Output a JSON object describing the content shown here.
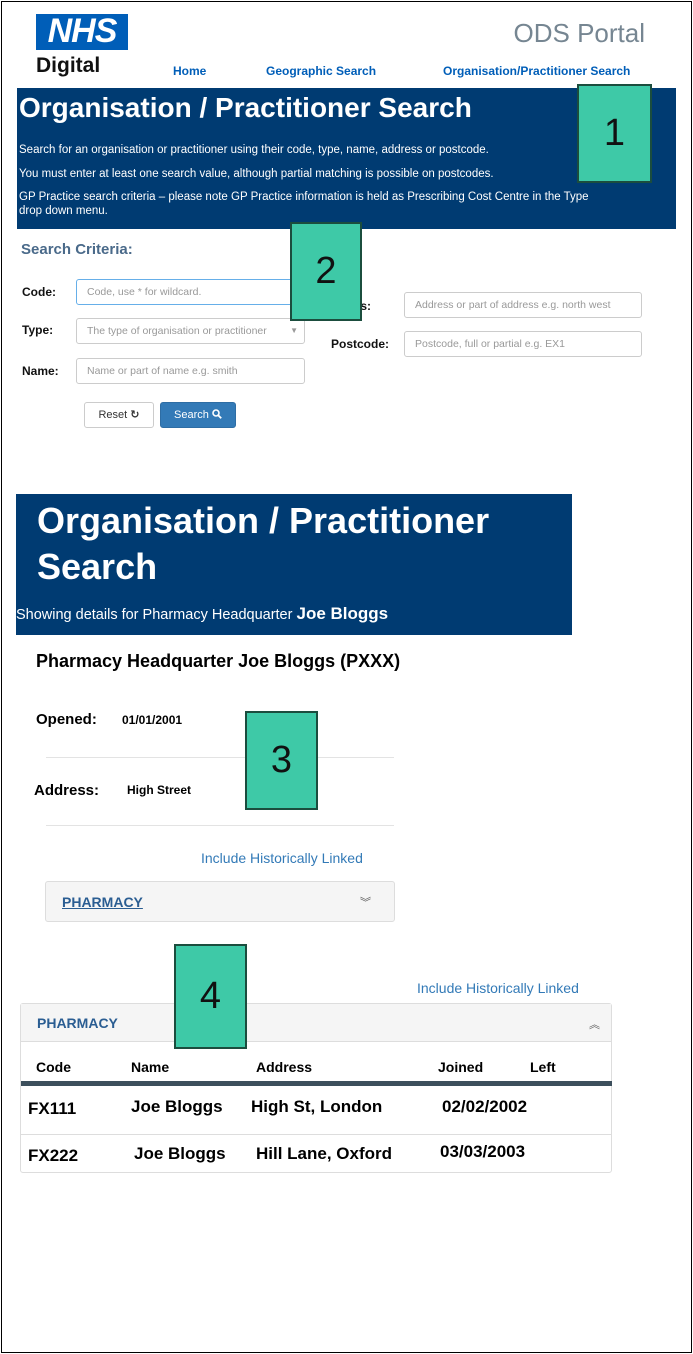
{
  "header": {
    "logo_nhs": "NHS",
    "logo_digital": "Digital",
    "portal_title": "ODS Portal",
    "nav": [
      "Home",
      "Geographic Search",
      "Organisation/Practitioner Search"
    ]
  },
  "banner1": {
    "title": "Organisation / Practitioner Search",
    "line1": "Search for an organisation or practitioner using their code, type, name, address or postcode.",
    "line2": "You must enter at least one search value, although partial matching is possible on postcodes.",
    "line3a": "GP Practice search criteria – please note GP Practice information is held as Prescribing Cost Centre in the Type",
    "line3b": "drop down menu."
  },
  "markers": [
    "1",
    "2",
    "3",
    "4"
  ],
  "search": {
    "title": "Search Criteria:",
    "code_label": "Code:",
    "code_placeholder": "Code, use * for wildcard.",
    "type_label": "Type:",
    "type_placeholder": "The type of organisation or practitioner",
    "name_label": "Name:",
    "name_placeholder": "Name or part of name e.g. smith",
    "address_label": "ess:",
    "address_placeholder": "Address or part of address e.g. north west",
    "postcode_label": "Postcode:",
    "postcode_placeholder": "Postcode, full or partial e.g. EX1",
    "reset_label": "Reset",
    "search_label": "Search"
  },
  "details": {
    "title_line1": "Organisation / Practitioner",
    "title_line2": "Search",
    "showing_prefix": "Showing details for Pharmacy Headquarter",
    "showing_name": "Joe Bloggs",
    "org_title": "Pharmacy Headquarter Joe Bloggs (PXXX)",
    "opened_label": "Opened:",
    "opened_value": "01/01/2001",
    "address_label": "Address:",
    "address_value": "High Street",
    "include_link": "Include Historically Linked",
    "panel_label": "PHARMACY"
  },
  "table": {
    "include_link": "Include Historically Linked",
    "panel_label": "PHARMACY",
    "columns": [
      "Code",
      "Name",
      "Address",
      "Joined",
      "Left"
    ],
    "rows": [
      {
        "code": "FX111",
        "name": "Joe Bloggs",
        "address": "High St, London",
        "joined": "02/02/2002",
        "left": ""
      },
      {
        "code": "FX222",
        "name": "Joe Bloggs",
        "address": "Hill Lane, Oxford",
        "joined": "03/03/2003",
        "left": ""
      }
    ]
  },
  "colors": {
    "nhs_blue": "#005eb8",
    "banner_navy": "#003b72",
    "marker_teal": "#3ec9a7",
    "link_blue": "#337ab7"
  }
}
